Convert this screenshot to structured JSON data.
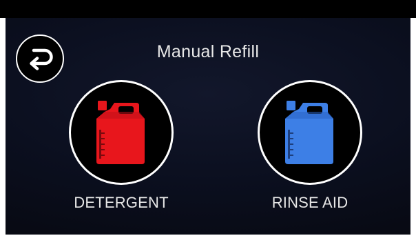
{
  "header": {
    "title": "Manual Refill"
  },
  "icons": {
    "back": "back-arrow-icon",
    "detergent": "jerrycan-icon",
    "rinse_aid": "jerrycan-icon"
  },
  "products": [
    {
      "label": "DETERGENT",
      "color": "#e8161c"
    },
    {
      "label": "RINSE AID",
      "color": "#3d7fe6"
    }
  ],
  "colors": {
    "background": "#0b0f1f",
    "text": "#e6e6e6",
    "outline": "#ffffff"
  }
}
